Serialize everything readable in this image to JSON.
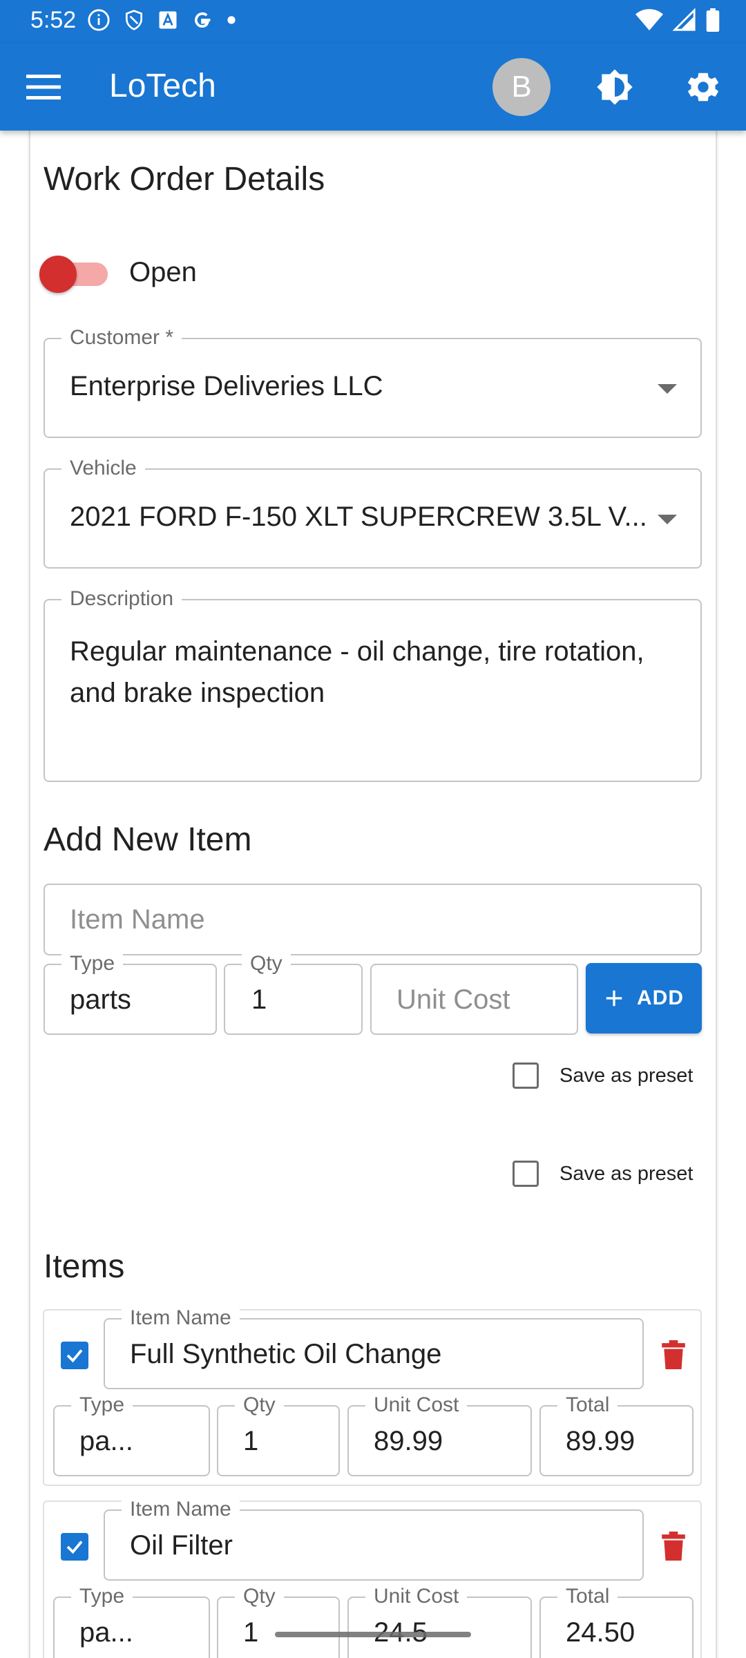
{
  "status_bar": {
    "time": "5:52",
    "left_icons": [
      "info-icon",
      "shield-icon",
      "font-icon",
      "google-icon",
      "dot-icon"
    ],
    "right_icons": [
      "wifi-icon",
      "signal-icon",
      "battery-icon"
    ]
  },
  "app_bar": {
    "title": "LoTech",
    "avatar_initial": "B",
    "color": "#1976d2"
  },
  "form": {
    "section_title": "Work Order Details",
    "status_label": "Open",
    "status_toggle_on": false,
    "customer": {
      "label": "Customer *",
      "value": "Enterprise Deliveries LLC"
    },
    "vehicle": {
      "label": "Vehicle",
      "value": "2021 FORD F-150 XLT SUPERCREW 3.5L V..."
    },
    "description": {
      "label": "Description",
      "value": "Regular maintenance - oil change, tire rotation, and brake inspection"
    }
  },
  "add_item": {
    "section_title": "Add New Item",
    "item_name_placeholder": "Item Name",
    "type": {
      "label": "Type",
      "value": "parts"
    },
    "qty": {
      "label": "Qty",
      "value": "1"
    },
    "unit_cost_placeholder": "Unit Cost",
    "add_button_label": "ADD",
    "save_preset_label_1": "Save as preset",
    "save_preset_label_2": "Save as preset"
  },
  "items": {
    "section_title": "Items",
    "rows": [
      {
        "checked": true,
        "name_label": "Item Name",
        "name": "Full Synthetic Oil Change",
        "type_label": "Type",
        "type": "pa...",
        "qty_label": "Qty",
        "qty": "1",
        "unit_cost_label": "Unit Cost",
        "unit_cost": "89.99",
        "total_label": "Total",
        "total": "89.99"
      },
      {
        "checked": true,
        "name_label": "Item Name",
        "name": "Oil Filter",
        "type_label": "Type",
        "type": "pa...",
        "qty_label": "Qty",
        "qty": "1",
        "unit_cost_label": "Unit Cost",
        "unit_cost": "24.5",
        "total_label": "Total",
        "total": "24.50"
      }
    ]
  },
  "colors": {
    "primary": "#1976d2",
    "danger": "#d32f2f",
    "toggle_track": "#f4a8a8"
  }
}
